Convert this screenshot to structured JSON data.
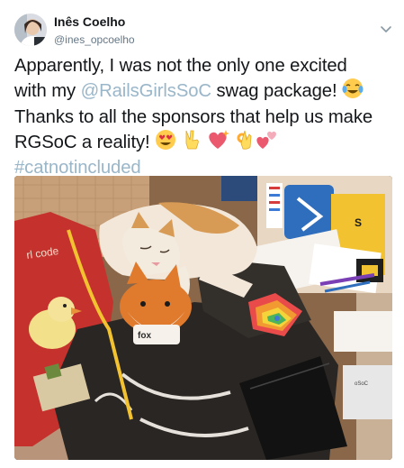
{
  "tweet": {
    "display_name": "Inês Coelho",
    "handle": "@ines_opcoelho",
    "text_line_1": "Apparently, I was not the only one excited",
    "text_line_2_pre": "with my ",
    "mention": "@RailsGirlsSoC",
    "text_line_2_post": " swag package! ",
    "text_line_3": "Thanks to all the sponsors that help us make",
    "text_line_4": "RGSoC a reality! ",
    "hashtag": "#catnotincluded",
    "emojis": [
      "face-with-tears-of-joy",
      "heart-eyes",
      "victory-hand",
      "sparkling-heart",
      "ok-hand",
      "two-hearts"
    ]
  },
  "media": {
    "visible_text": [
      "rl code",
      "oSoC",
      "S",
      "fox"
    ]
  },
  "colors": {
    "link": "#9ab6c9",
    "text": "#14171a",
    "secondary": "#657786"
  }
}
